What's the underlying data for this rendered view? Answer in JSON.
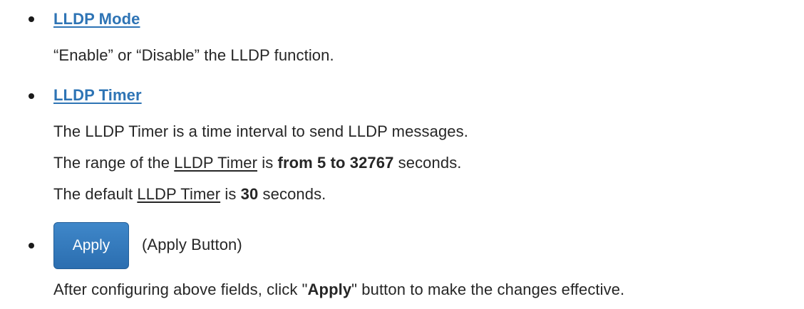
{
  "items": [
    {
      "heading": "LLDP Mode",
      "lines": [
        "“Enable” or “Disable” the LLDP function."
      ]
    },
    {
      "heading": "LLDP Timer",
      "line1": "The LLDP Timer is a time interval to send LLDP messages.",
      "line2": {
        "prefix": "The range of the ",
        "term": "LLDP Timer",
        "middle": " is ",
        "range": "from 5 to 32767",
        "suffix": " seconds."
      },
      "line3": {
        "prefix": "The default ",
        "term": "LLDP Timer",
        "middle": " is ",
        "value": "30",
        "suffix": " seconds."
      }
    }
  ],
  "apply": {
    "button_label": "Apply",
    "caption": "(Apply Button)",
    "desc_prefix": "After configuring above fields, click \"",
    "desc_bold": "Apply",
    "desc_suffix": "\" button to make the changes effective."
  },
  "colors": {
    "heading": "#2e74b5",
    "button": "#3579bd",
    "text": "#262626"
  }
}
